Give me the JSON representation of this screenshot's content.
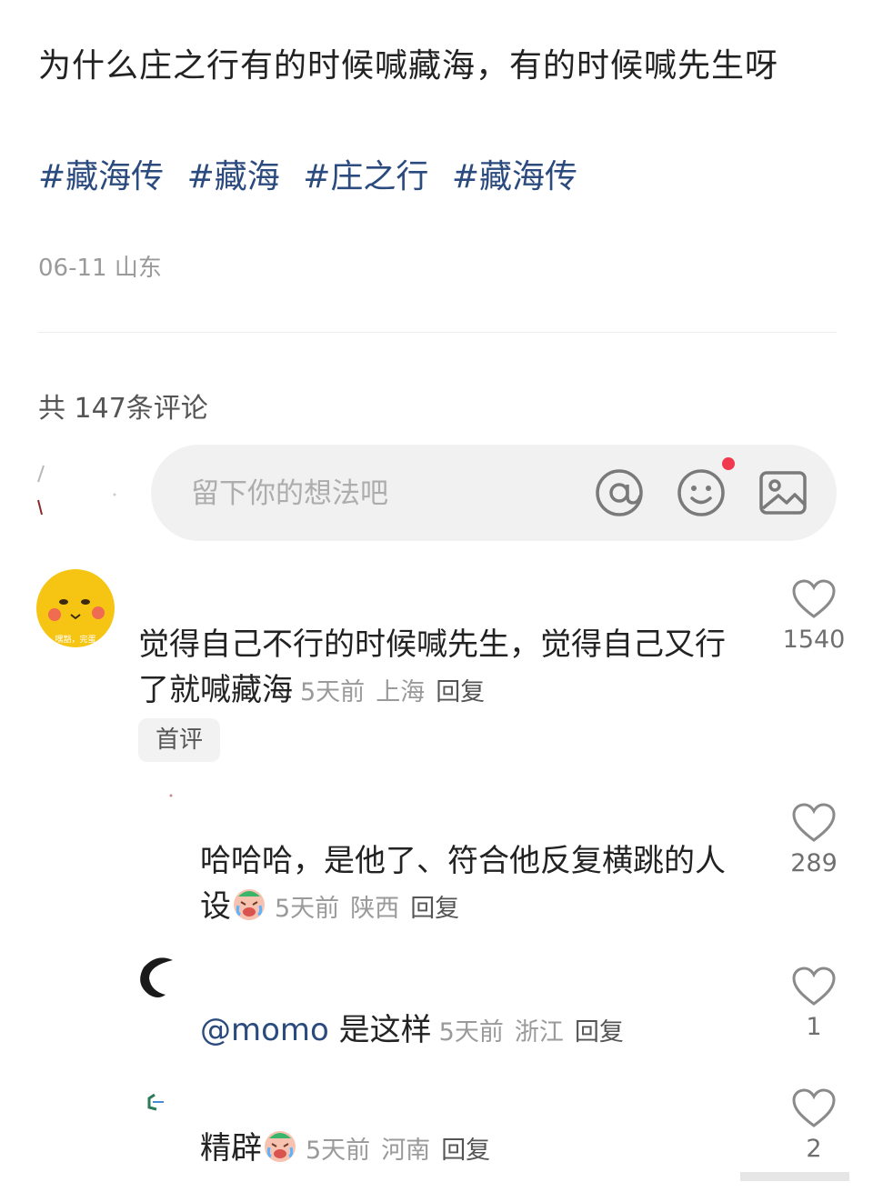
{
  "post": {
    "title": "为什么庄之行有的时候喊藏海，有的时候喊先生呀",
    "tags": [
      "#藏海传",
      "#藏海",
      "#庄之行",
      "#藏海传"
    ],
    "date": "06-11",
    "location": "山东"
  },
  "comments_header": "共 147条评论",
  "comment_input": {
    "placeholder": "留下你的想法吧"
  },
  "comments": [
    {
      "text": "觉得自己不行的时候喊先生，觉得自己又行了就喊藏海",
      "time": "5天前",
      "location": "上海",
      "reply": "回复",
      "badge": "首评",
      "likes": "1540",
      "avatar_text": "嘿豁，完蛋"
    },
    {
      "text": "哈哈哈，是他了、符合他反复横跳的人设",
      "time": "5天前",
      "location": "陕西",
      "reply": "回复",
      "likes": "289"
    },
    {
      "mention": "@momo",
      "text": "是这样",
      "time": "5天前",
      "location": "浙江",
      "reply": "回复",
      "likes": "1"
    },
    {
      "text": "精辟",
      "time": "5天前",
      "location": "河南",
      "reply": "回复",
      "likes": "2"
    }
  ],
  "colors": {
    "link": "#2b4a7e",
    "meta": "#9a9a9a",
    "notify": "#f0384f"
  }
}
